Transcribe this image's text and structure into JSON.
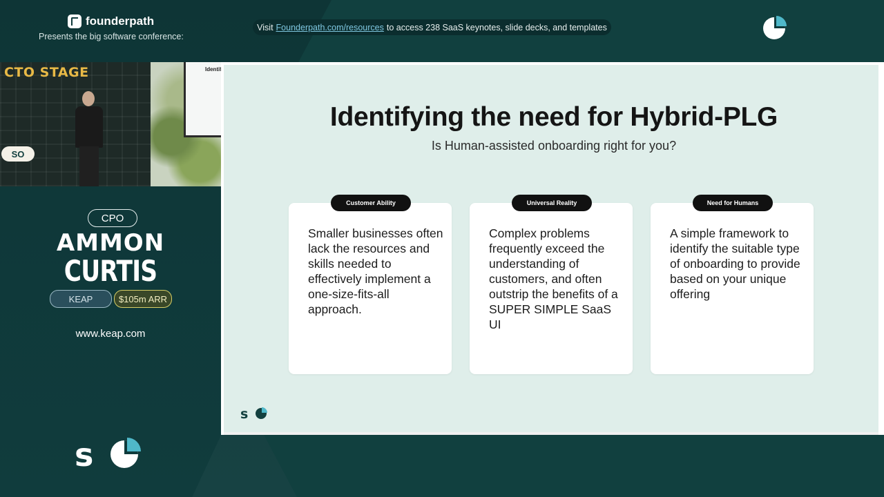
{
  "header": {
    "brand_name": "founderpath",
    "presents": "Presents the big software conference:",
    "visit_prefix": "Visit",
    "visit_link": "Founderpath.com/resources",
    "visit_suffix": "to access 238 SaaS keynotes, slide decks, and templates"
  },
  "camera": {
    "stage_label": "CTO STAGE",
    "monitor_text": "Identif",
    "logo_text": "SO"
  },
  "speaker": {
    "role": "CPO",
    "first_name": "AMMON",
    "last_name": "CURTIS",
    "company": "KEAP",
    "arr": "$105m ARR",
    "website": "www.keap.com"
  },
  "slide": {
    "title": "Identifying the need for Hybrid-PLG",
    "subtitle": "Is Human-assisted onboarding right for you?",
    "cards": [
      {
        "tag": "Customer Ability",
        "body": "Smaller businesses often lack the resources and skills needed to effectively implement a one-size-fits-all approach."
      },
      {
        "tag": "Universal Reality",
        "body": "Complex problems frequently exceed the understanding of customers, and often outstrip the benefits of a SUPER SIMPLE SaaS UI"
      },
      {
        "tag": "Need for Humans",
        "body": "A simple framework to identify the suitable type of onboarding to provide based on your unique offering"
      }
    ]
  },
  "colors": {
    "background": "#0f3a3b",
    "accent_teal": "#4fb8c9",
    "slide_bg": "#dfeeea"
  },
  "icons": {
    "header_logo": "founderpath-logo-icon",
    "top_right": "pie-chart-logo-icon",
    "bottom_left": "saastr-so-logo-icon"
  }
}
